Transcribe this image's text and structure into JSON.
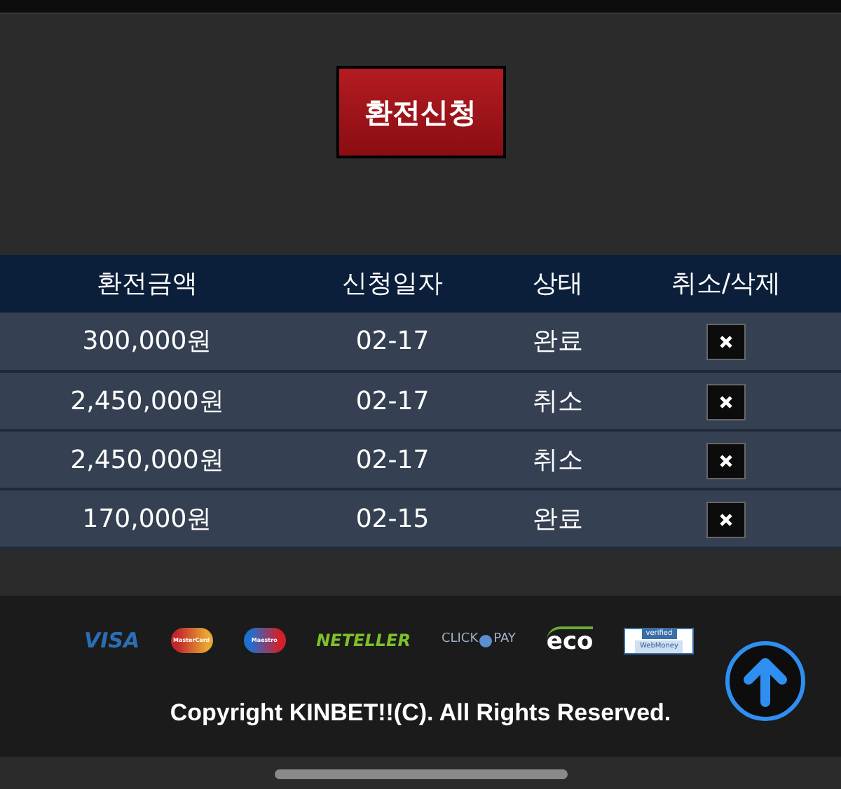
{
  "request_button": {
    "label": "환전신청"
  },
  "table": {
    "columns": [
      "환전금액",
      "신청일자",
      "상태",
      "취소/삭제"
    ],
    "rows": [
      {
        "amount": "300,000원",
        "date": "02-17",
        "status": "완료"
      },
      {
        "amount": "2,450,000원",
        "date": "02-17",
        "status": "취소"
      },
      {
        "amount": "2,450,000원",
        "date": "02-17",
        "status": "취소"
      },
      {
        "amount": "170,000원",
        "date": "02-15",
        "status": "완료"
      }
    ]
  },
  "payment_logos": [
    {
      "kind": "visa",
      "label": "VISA"
    },
    {
      "kind": "mastercard",
      "label": "MasterCard"
    },
    {
      "kind": "maestro",
      "label": "Maestro"
    },
    {
      "kind": "neteller",
      "label": "NETELLER"
    },
    {
      "kind": "click2pay",
      "label": "CLICK",
      "label_2": "PAY"
    },
    {
      "kind": "eco",
      "label": "eco"
    },
    {
      "kind": "webmoney",
      "label": "verified",
      "label_2": "WebMoney"
    }
  ],
  "copyright": "Copyright KINBET!!(C). All Rights Reserved."
}
